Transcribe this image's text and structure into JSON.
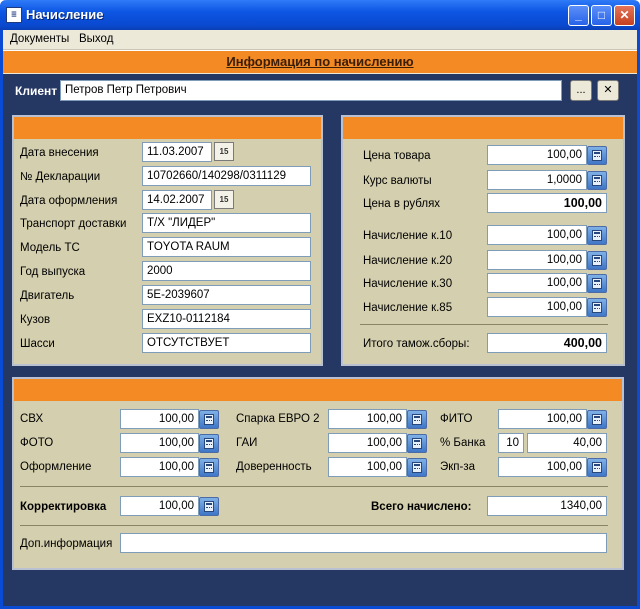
{
  "window": {
    "title": "Начисление",
    "icon": "app-icon"
  },
  "menu": {
    "items": [
      "Документы",
      "Выход"
    ]
  },
  "header": {
    "title": "Информация по начислению"
  },
  "client": {
    "label": "Клиент",
    "value": "Петров Петр Петрович",
    "browse_label": "...",
    "clear_label": "✕"
  },
  "left_panel": {
    "rows": [
      {
        "label": "Дата внесения",
        "value": "11.03.2007",
        "calendar": true
      },
      {
        "label": "№ Декларации",
        "value": "10702660/140298/0311129"
      },
      {
        "label": "Дата оформления",
        "value": "14.02.2007",
        "calendar": true
      },
      {
        "label": "Транспорт доставки",
        "value": "Т/Х \"ЛИДЕР\""
      },
      {
        "label": "Модель ТС",
        "value": "TOYOTA RAUM"
      },
      {
        "label": "Год выпуска",
        "value": "2000"
      },
      {
        "label": "Двигатель",
        "value": "5E-2039607"
      },
      {
        "label": "Кузов",
        "value": "EXZ10-0112184"
      },
      {
        "label": "Шасси",
        "value": "ОТСУТСТВУЕТ"
      }
    ]
  },
  "right_panel": {
    "price_goods": {
      "label": "Цена товара",
      "value": "100,00"
    },
    "fx_rate": {
      "label": "Курс валюты",
      "value": "1,0000"
    },
    "price_rub": {
      "label": "Цена в рублях",
      "value": "100,00"
    },
    "charges": [
      {
        "label": "Начисление к.10",
        "value": "100,00"
      },
      {
        "label": "Начисление к.20",
        "value": "100,00"
      },
      {
        "label": "Начисление к.30",
        "value": "100,00"
      },
      {
        "label": "Начисление к.85",
        "value": "100,00"
      }
    ],
    "total_customs": {
      "label": "Итого тамож.сборы:",
      "value": "400,00"
    }
  },
  "bottom_panel": {
    "col1": [
      {
        "label": "СВХ",
        "value": "100,00"
      },
      {
        "label": "ФОТО",
        "value": "100,00"
      },
      {
        "label": "Оформление",
        "value": "100,00"
      }
    ],
    "col2": [
      {
        "label": "Спарка ЕВРО 2",
        "value": "100,00"
      },
      {
        "label": "ГАИ",
        "value": "100,00"
      },
      {
        "label": "Доверенность",
        "value": "100,00"
      }
    ],
    "fito": {
      "label": "ФИТО",
      "value": "100,00"
    },
    "bank": {
      "label": "% Банка",
      "percent": "10",
      "value": "40,00"
    },
    "expertise": {
      "label": "Экп-за",
      "value": "100,00"
    },
    "correction": {
      "label": "Корректировка",
      "value": "100,00"
    },
    "total": {
      "label": "Всего начислено:",
      "value": "1340,00"
    },
    "extra_info": {
      "label": "Доп.информация",
      "value": ""
    }
  }
}
